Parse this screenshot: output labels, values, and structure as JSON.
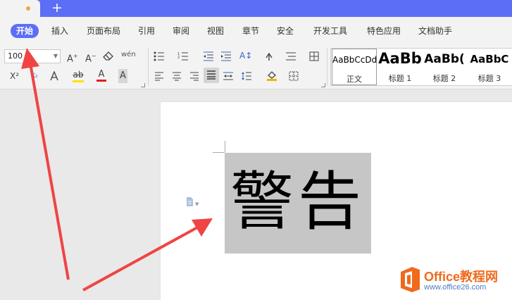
{
  "window": {
    "new_tab_symbol": "+"
  },
  "menu": {
    "items": [
      "开始",
      "插入",
      "页面布局",
      "引用",
      "审阅",
      "视图",
      "章节",
      "安全",
      "开发工具",
      "特色应用",
      "文档助手"
    ],
    "active_index": 0
  },
  "toolbar": {
    "font_size": "100",
    "superscript": "X²",
    "subscript": "X₂",
    "styles": [
      {
        "sample": "AaBbCcDd",
        "label": "正文"
      },
      {
        "sample": "AaBb",
        "label": "标题 1"
      },
      {
        "sample": "AaBb(",
        "label": "标题 2"
      },
      {
        "sample": "AaBbC",
        "label": "标题 3"
      }
    ]
  },
  "document": {
    "text": "警告"
  },
  "watermark": {
    "title": "Office教程网",
    "url": "www.office26.com"
  },
  "colors": {
    "tab_bar": "#5b6ef5",
    "active_menu": "#5b6ef5",
    "arrow": "#f04444",
    "highlight": "#c6c6c6",
    "logo_orange": "#ef6a1c"
  },
  "icons": [
    "plus-icon",
    "font-grow-icon",
    "font-shrink-icon",
    "clear-format-icon",
    "pinyin-icon",
    "bullets-icon",
    "numbering-icon",
    "indent-icon",
    "outdent-icon",
    "sort-icon",
    "table-icon",
    "align-left-icon",
    "align-center-icon",
    "align-right-icon",
    "justify-icon",
    "distribute-icon",
    "line-spacing-icon",
    "shading-icon",
    "borders-icon",
    "document-icon"
  ]
}
